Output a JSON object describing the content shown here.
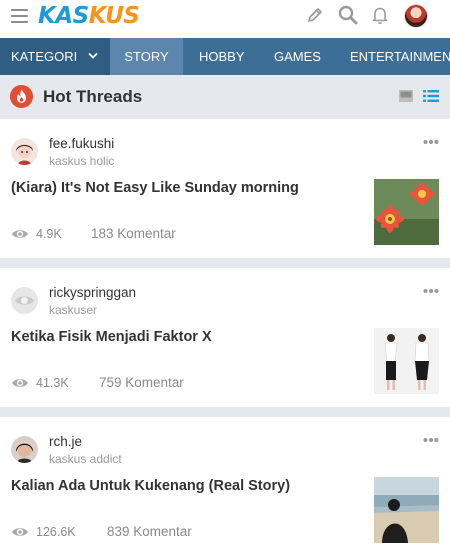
{
  "brand": {
    "logo_part1": "KAS",
    "logo_part2": "KUS"
  },
  "topbar_icons": [
    "hamburger-menu-icon",
    "pencil-icon",
    "search-icon",
    "bell-icon",
    "user-avatar"
  ],
  "nav": {
    "kategori": "KATEGORI",
    "tabs": [
      "STORY",
      "HOBBY",
      "GAMES",
      "ENTERTAINMENT"
    ],
    "active_tab": "STORY"
  },
  "section": {
    "title": "Hot Threads"
  },
  "threads": [
    {
      "user": "fee.fukushi",
      "rank": "kaskus holic",
      "title": "(Kiara) It's Not Easy Like Sunday morning",
      "views": "4.9K",
      "comments": "183 Komentar"
    },
    {
      "user": "rickyspringgan",
      "rank": "kaskuser",
      "title": "Ketika Fisik Menjadi Faktor X",
      "views": "41.3K",
      "comments": "759 Komentar"
    },
    {
      "user": "rch.je",
      "rank": "kaskus addict",
      "title": "Kalian Ada Untuk Kukenang (Real Story)",
      "views": "126.6K",
      "comments": "839 Komentar"
    }
  ],
  "colors": {
    "brand_blue": "#1d9bd8",
    "brand_orange": "#f7931e",
    "nav_bg": "#3c6e98",
    "nav_active": "#5c86ad",
    "accent_list": "#1d9bd8",
    "fire": "#e24d33"
  }
}
